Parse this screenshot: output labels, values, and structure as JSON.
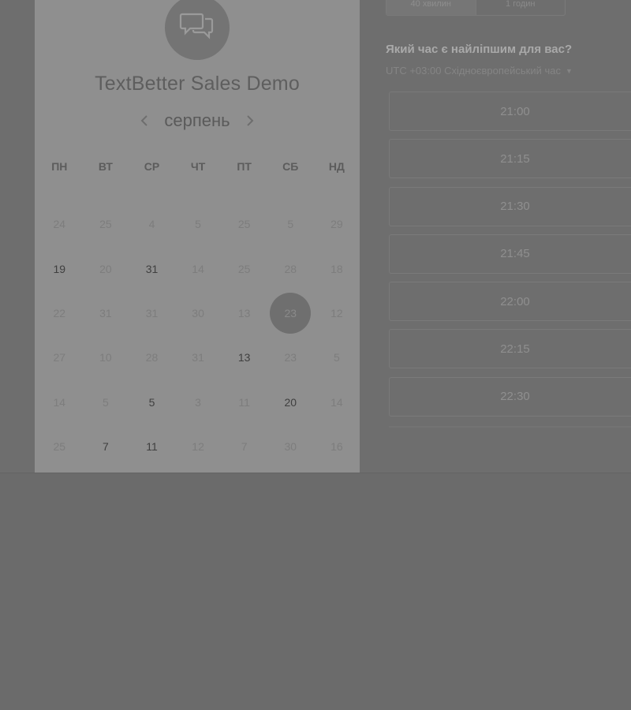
{
  "event": {
    "title": "TextBetter Sales Demo",
    "logo_icon": "chat-bubbles-icon"
  },
  "calendar": {
    "month": "серпень",
    "prev_icon": "chevron-left-icon",
    "next_icon": "chevron-right-icon",
    "weekdays": [
      "ПН",
      "ВТ",
      "СР",
      "ЧТ",
      "ПТ",
      "СБ",
      "НД"
    ],
    "weeks": [
      [
        {
          "d": "24",
          "s": "disabled"
        },
        {
          "d": "25",
          "s": "disabled"
        },
        {
          "d": "4",
          "s": "disabled"
        },
        {
          "d": "5",
          "s": "disabled"
        },
        {
          "d": "25",
          "s": "disabled"
        },
        {
          "d": "5",
          "s": "disabled"
        },
        {
          "d": "29",
          "s": "disabled"
        }
      ],
      [
        {
          "d": "19",
          "s": "available"
        },
        {
          "d": "20",
          "s": "disabled"
        },
        {
          "d": "31",
          "s": "available"
        },
        {
          "d": "14",
          "s": "disabled"
        },
        {
          "d": "25",
          "s": "disabled"
        },
        {
          "d": "28",
          "s": "disabled"
        },
        {
          "d": "18",
          "s": "disabled"
        }
      ],
      [
        {
          "d": "22",
          "s": "disabled"
        },
        {
          "d": "31",
          "s": "disabled"
        },
        {
          "d": "31",
          "s": "disabled"
        },
        {
          "d": "30",
          "s": "disabled"
        },
        {
          "d": "13",
          "s": "disabled"
        },
        {
          "d": "23",
          "s": "selected"
        },
        {
          "d": "12",
          "s": "disabled"
        }
      ],
      [
        {
          "d": "27",
          "s": "disabled"
        },
        {
          "d": "10",
          "s": "disabled"
        },
        {
          "d": "28",
          "s": "disabled"
        },
        {
          "d": "31",
          "s": "disabled"
        },
        {
          "d": "13",
          "s": "available"
        },
        {
          "d": "23",
          "s": "disabled"
        },
        {
          "d": "5",
          "s": "disabled"
        }
      ],
      [
        {
          "d": "14",
          "s": "disabled"
        },
        {
          "d": "5",
          "s": "disabled"
        },
        {
          "d": "5",
          "s": "available"
        },
        {
          "d": "3",
          "s": "disabled"
        },
        {
          "d": "11",
          "s": "disabled"
        },
        {
          "d": "20",
          "s": "available"
        },
        {
          "d": "14",
          "s": "disabled"
        }
      ],
      [
        {
          "d": "25",
          "s": "disabled"
        },
        {
          "d": "7",
          "s": "available"
        },
        {
          "d": "11",
          "s": "available"
        },
        {
          "d": "12",
          "s": "disabled"
        },
        {
          "d": "7",
          "s": "disabled"
        },
        {
          "d": "30",
          "s": "disabled"
        },
        {
          "d": "16",
          "s": "disabled"
        }
      ]
    ]
  },
  "duration": {
    "options": [
      "40 хвилин",
      "1 годин"
    ]
  },
  "times": {
    "question": "Який час є найліпшим для вас?",
    "timezone": "UTC +03:00 Східноєвропейський час",
    "timezone_icon": "caret-down-icon",
    "slots": [
      "21:00",
      "21:15",
      "21:30",
      "21:45",
      "22:00",
      "22:15",
      "22:30"
    ]
  },
  "colors": {
    "overlay_background": "#6e6e6e",
    "card_background": "#8f8f8f",
    "selected_day": "#6f6f6f"
  }
}
